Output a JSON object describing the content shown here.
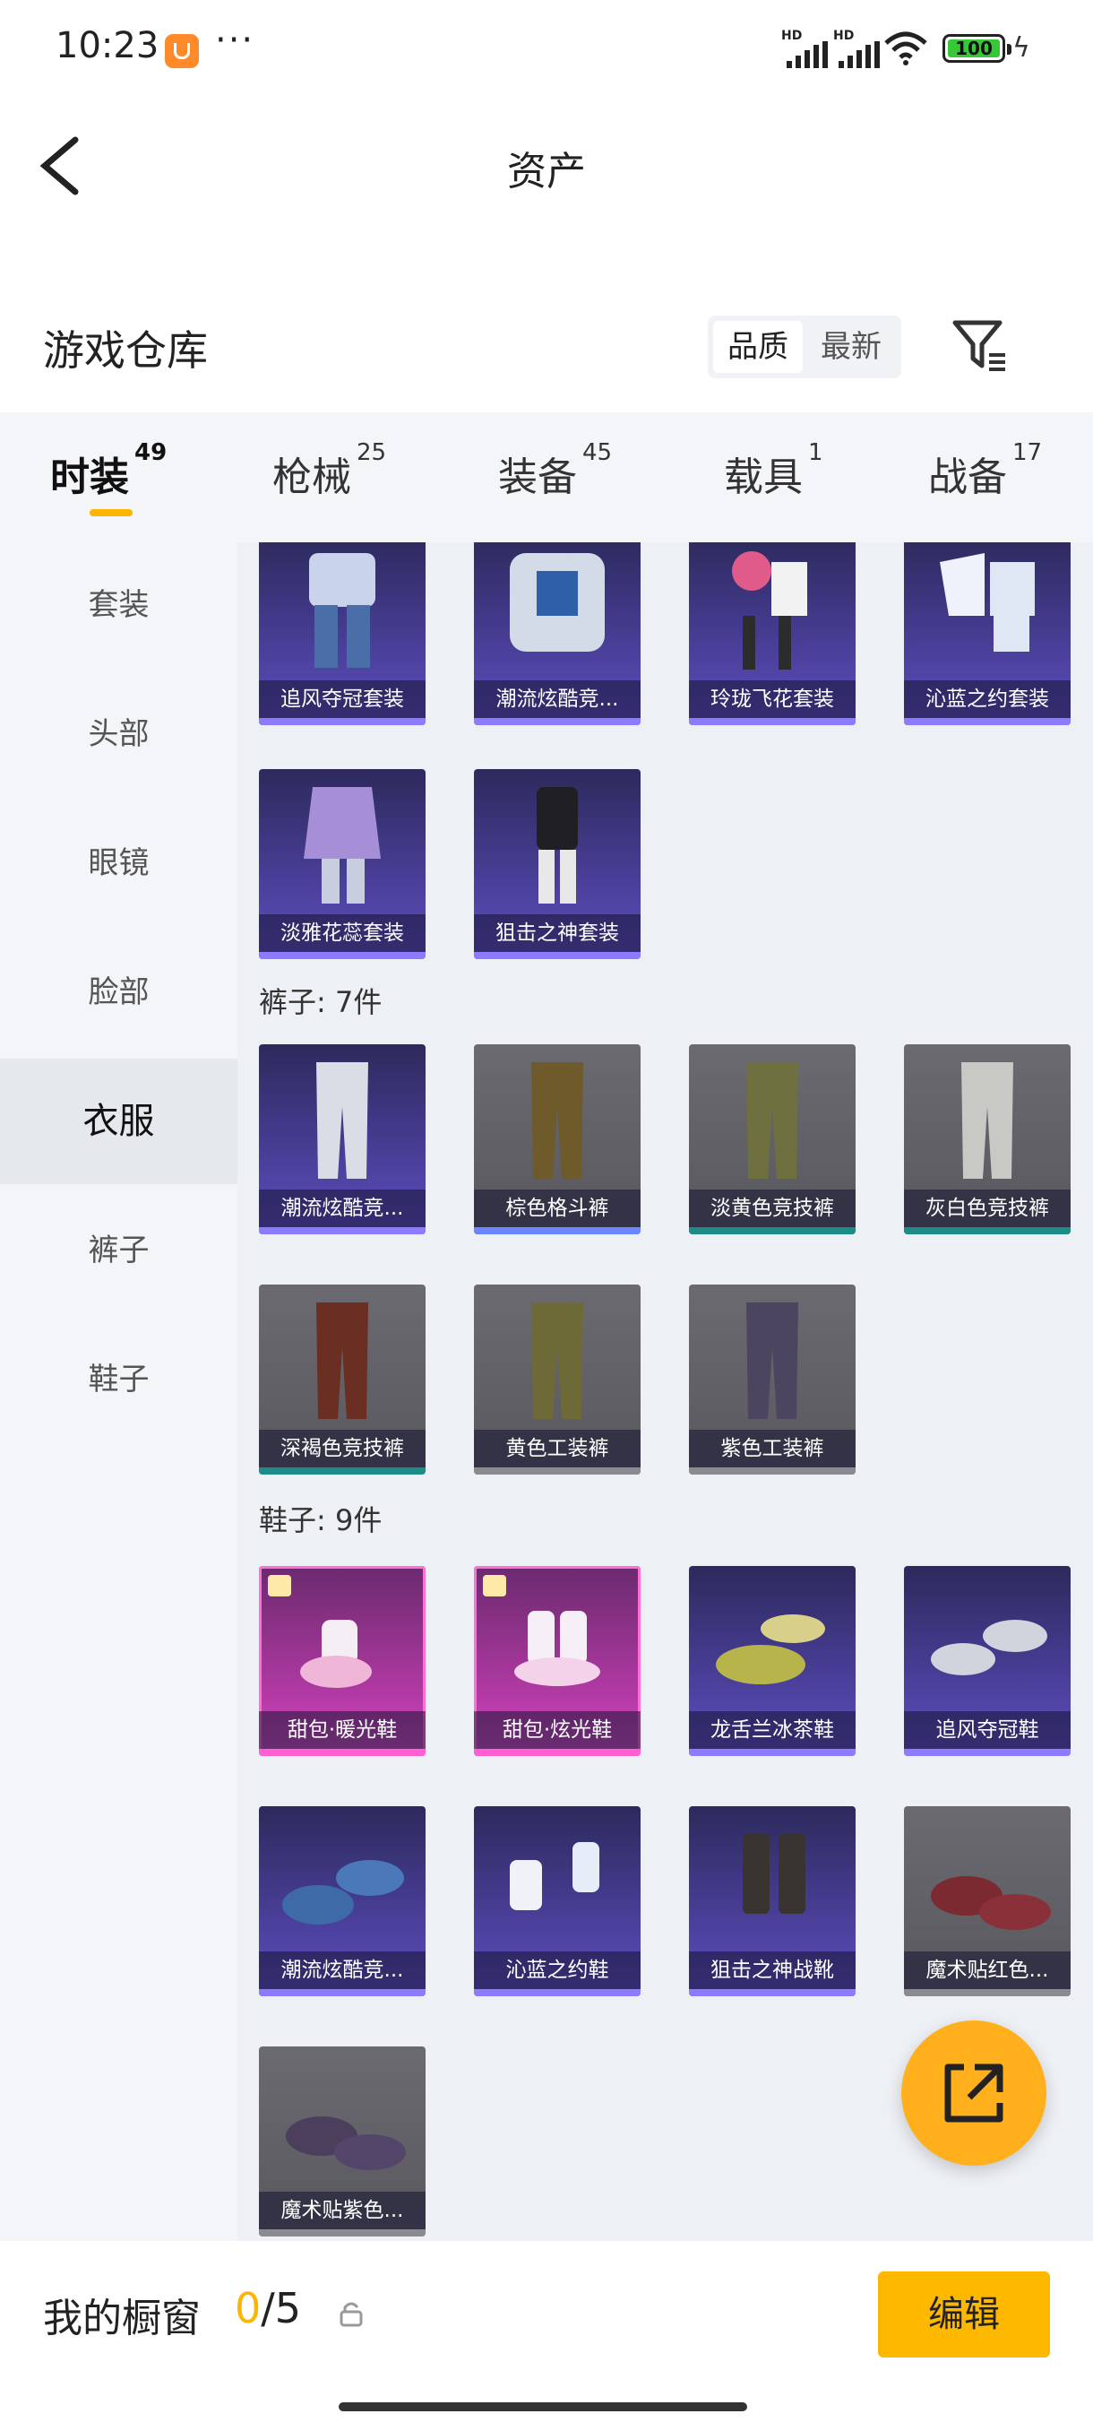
{
  "status_bar": {
    "time": "10:23",
    "more": "···",
    "battery": "100",
    "hd1": "HD",
    "hd2": "HD"
  },
  "header": {
    "title": "资产"
  },
  "warehouse": {
    "title": "游戏仓库",
    "sort_quality": "品质",
    "sort_newest": "最新"
  },
  "tabs": [
    {
      "label": "时装",
      "count": "49"
    },
    {
      "label": "枪械",
      "count": "25"
    },
    {
      "label": "装备",
      "count": "45"
    },
    {
      "label": "载具",
      "count": "1"
    },
    {
      "label": "战备",
      "count": "17"
    }
  ],
  "sidebar": [
    {
      "label": "套装"
    },
    {
      "label": "头部"
    },
    {
      "label": "眼镜"
    },
    {
      "label": "脸部"
    },
    {
      "label": "衣服"
    },
    {
      "label": "裤子"
    },
    {
      "label": "鞋子"
    }
  ],
  "groups": {
    "suits": {
      "items": [
        {
          "name": "追风夺冠套装"
        },
        {
          "name": "潮流炫酷竞..."
        },
        {
          "name": "玲珑飞花套装"
        },
        {
          "name": "沁蓝之约套装"
        },
        {
          "name": "淡雅花蕊套装"
        },
        {
          "name": "狙击之神套装"
        }
      ]
    },
    "pants": {
      "heading": "裤子: 7件",
      "items": [
        {
          "name": "潮流炫酷竞..."
        },
        {
          "name": "棕色格斗裤"
        },
        {
          "name": "淡黄色竞技裤"
        },
        {
          "name": "灰白色竞技裤"
        },
        {
          "name": "深褐色竞技裤"
        },
        {
          "name": "黄色工装裤"
        },
        {
          "name": "紫色工装裤"
        }
      ]
    },
    "shoes": {
      "heading": "鞋子: 9件",
      "items": [
        {
          "name": "甜包·暖光鞋"
        },
        {
          "name": "甜包·炫光鞋"
        },
        {
          "name": "龙舌兰冰茶鞋"
        },
        {
          "name": "追风夺冠鞋"
        },
        {
          "name": "潮流炫酷竞..."
        },
        {
          "name": "沁蓝之约鞋"
        },
        {
          "name": "狙击之神战靴"
        },
        {
          "name": "魔术贴红色..."
        },
        {
          "name": "魔术贴紫色..."
        }
      ]
    }
  },
  "showcase": {
    "label": "我的橱窗",
    "current": "0",
    "total": "/5",
    "edit_label": "编辑"
  },
  "colors": {
    "accent": "#ffb400",
    "purple_rarity": "#8a7bff",
    "pink_rarity": "#ff5fd0",
    "teal_rarity": "#1f8b87"
  }
}
